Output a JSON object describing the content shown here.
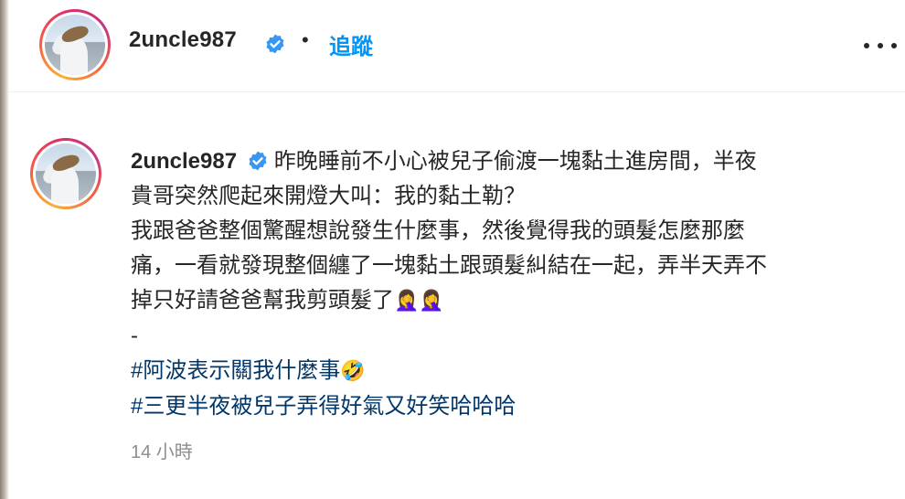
{
  "header": {
    "username": "2uncle987",
    "separator": "•",
    "follow_label": "追蹤",
    "more_icon": "more-horizontal-icon"
  },
  "caption": {
    "username": "2uncle987",
    "lines": [
      "昨晚睡前不小心被兒子偷渡一塊黏土進房間，半夜",
      "貴哥突然爬起來開燈大叫：我的黏土勒？",
      "我跟爸爸整個驚醒想說發生什麼事，然後覺得我的頭髮怎麼那麼",
      "痛，一看就發現整個纏了一塊黏土跟頭髮糾結在一起，弄半天弄不",
      "掉只好請爸爸幫我剪頭髮了",
      "-"
    ],
    "emojis_line5": [
      "🤦‍♀️",
      "🤦‍♀️"
    ],
    "hashtags": [
      {
        "text": "#阿波表示關我什麼事",
        "emoji": "🤣"
      },
      {
        "text": "#三更半夜被兒子弄得好氣又好笑哈哈哈",
        "emoji": ""
      }
    ]
  },
  "timestamp": "14 小時",
  "colors": {
    "follow_blue": "#0095f6",
    "hashtag_blue": "#00376b",
    "verified_blue": "#3897f0",
    "timestamp_gray": "#8e8e8e"
  }
}
